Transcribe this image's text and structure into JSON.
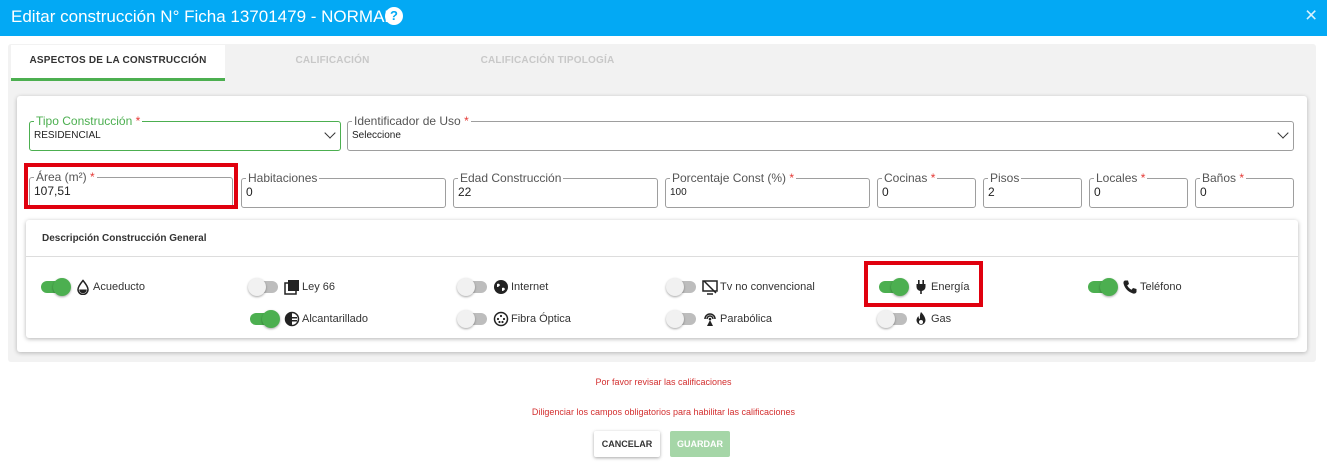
{
  "header": {
    "title": "Editar construcción N° Ficha 13701479 - NORMAL",
    "help_icon": "?",
    "close_icon": "×"
  },
  "tabs": [
    {
      "label": "ASPECTOS DE LA CONSTRUCCIÓN",
      "active": true
    },
    {
      "label": "CALIFICACIÓN",
      "active": false
    },
    {
      "label": "CALIFICACIÓN TIPOLOGÍA",
      "active": false
    }
  ],
  "fields": {
    "tipo": {
      "label": "Tipo Construcción",
      "value": "RESIDENCIAL",
      "required": "*"
    },
    "uso": {
      "label": "Identificador de Uso",
      "value": "Seleccione",
      "required": "*"
    },
    "area": {
      "label": "Área (m²)",
      "value": "107,51",
      "required": "*"
    },
    "habitaciones": {
      "label": "Habitaciones",
      "value": "0"
    },
    "edad": {
      "label": "Edad Construcción",
      "value": "22"
    },
    "porcentaje": {
      "label": "Porcentaje Const (%)",
      "value": "100",
      "required": "*"
    },
    "cocinas": {
      "label": "Cocinas",
      "value": "0",
      "required": "*"
    },
    "pisos": {
      "label": "Pisos",
      "value": "2"
    },
    "locales": {
      "label": "Locales",
      "value": "0",
      "required": "*"
    },
    "banos": {
      "label": "Baños",
      "value": "0",
      "required": "*"
    }
  },
  "description": {
    "title": "Descripción Construcción General",
    "items": [
      {
        "label": "Acueducto",
        "on": true,
        "icon": "water-drop-icon"
      },
      {
        "label": "Ley 66",
        "on": false,
        "icon": "layers-icon"
      },
      {
        "label": "Internet",
        "on": false,
        "icon": "globe-icon"
      },
      {
        "label": "Tv no convencional",
        "on": false,
        "icon": "tv-icon"
      },
      {
        "label": "Energía",
        "on": true,
        "icon": "plug-icon"
      },
      {
        "label": "Teléfono",
        "on": true,
        "icon": "phone-icon"
      },
      {
        "label": "Alcantarillado",
        "on": true,
        "icon": "half-circle-icon"
      },
      {
        "label": "Fibra Óptica",
        "on": false,
        "icon": "fiber-icon"
      },
      {
        "label": "Parabólica",
        "on": false,
        "icon": "satellite-icon"
      },
      {
        "label": "Gas",
        "on": false,
        "icon": "flame-icon"
      }
    ]
  },
  "messages": {
    "review": "Por favor revisar las calificaciones",
    "required": "Diligenciar los campos obligatorios para habilitar las calificaciones"
  },
  "buttons": {
    "cancel": "CANCELAR",
    "save": "GUARDAR"
  },
  "colors": {
    "header": "#03a9f4",
    "accent": "#4caf50",
    "highlight": "#e0000e",
    "error": "#d32f2f"
  }
}
